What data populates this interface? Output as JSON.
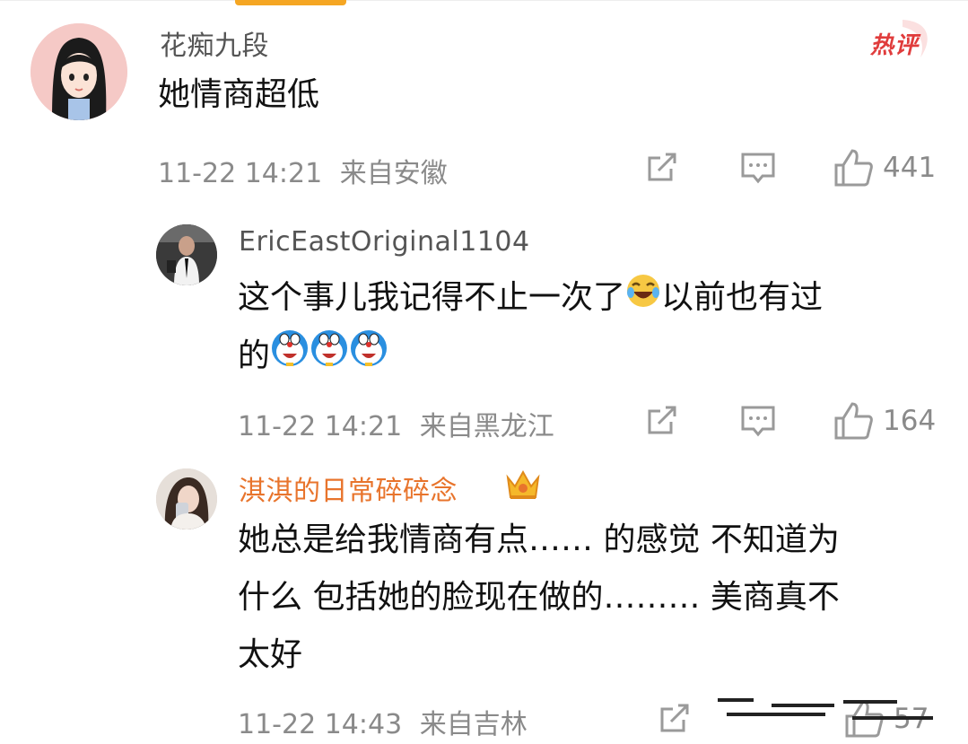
{
  "comments": [
    {
      "username": "花痴九段",
      "badge": "热评",
      "content_lines": [
        "她情商超低"
      ],
      "time": "11-22 14:21",
      "location": "来自安徽",
      "likes": "441"
    },
    {
      "username": "EricEastOriginal1104",
      "content_lines": [
        "这个事儿我记得不止一次了",
        "以前也有过",
        "的"
      ],
      "time": "11-22 14:21",
      "location": "来自黑龙江",
      "likes": "164"
    },
    {
      "username": "淇淇的日常碎碎念",
      "content_lines": [
        "她总是给我情商有点…… 的感觉 不知道为",
        "什么 包括她的脸现在做的……… 美商真不",
        "太好"
      ],
      "time": "11-22 14:43",
      "location": "来自吉林",
      "likes": "57"
    }
  ],
  "colors": {
    "accent": "#f5a623",
    "hot": "#e03c3c",
    "vip_name": "#e8742c",
    "meta": "#8a8a8a"
  },
  "icons": [
    "share-icon",
    "comment-icon",
    "like-icon",
    "laughing-emoji",
    "doraemon-emoji",
    "crown-icon"
  ]
}
